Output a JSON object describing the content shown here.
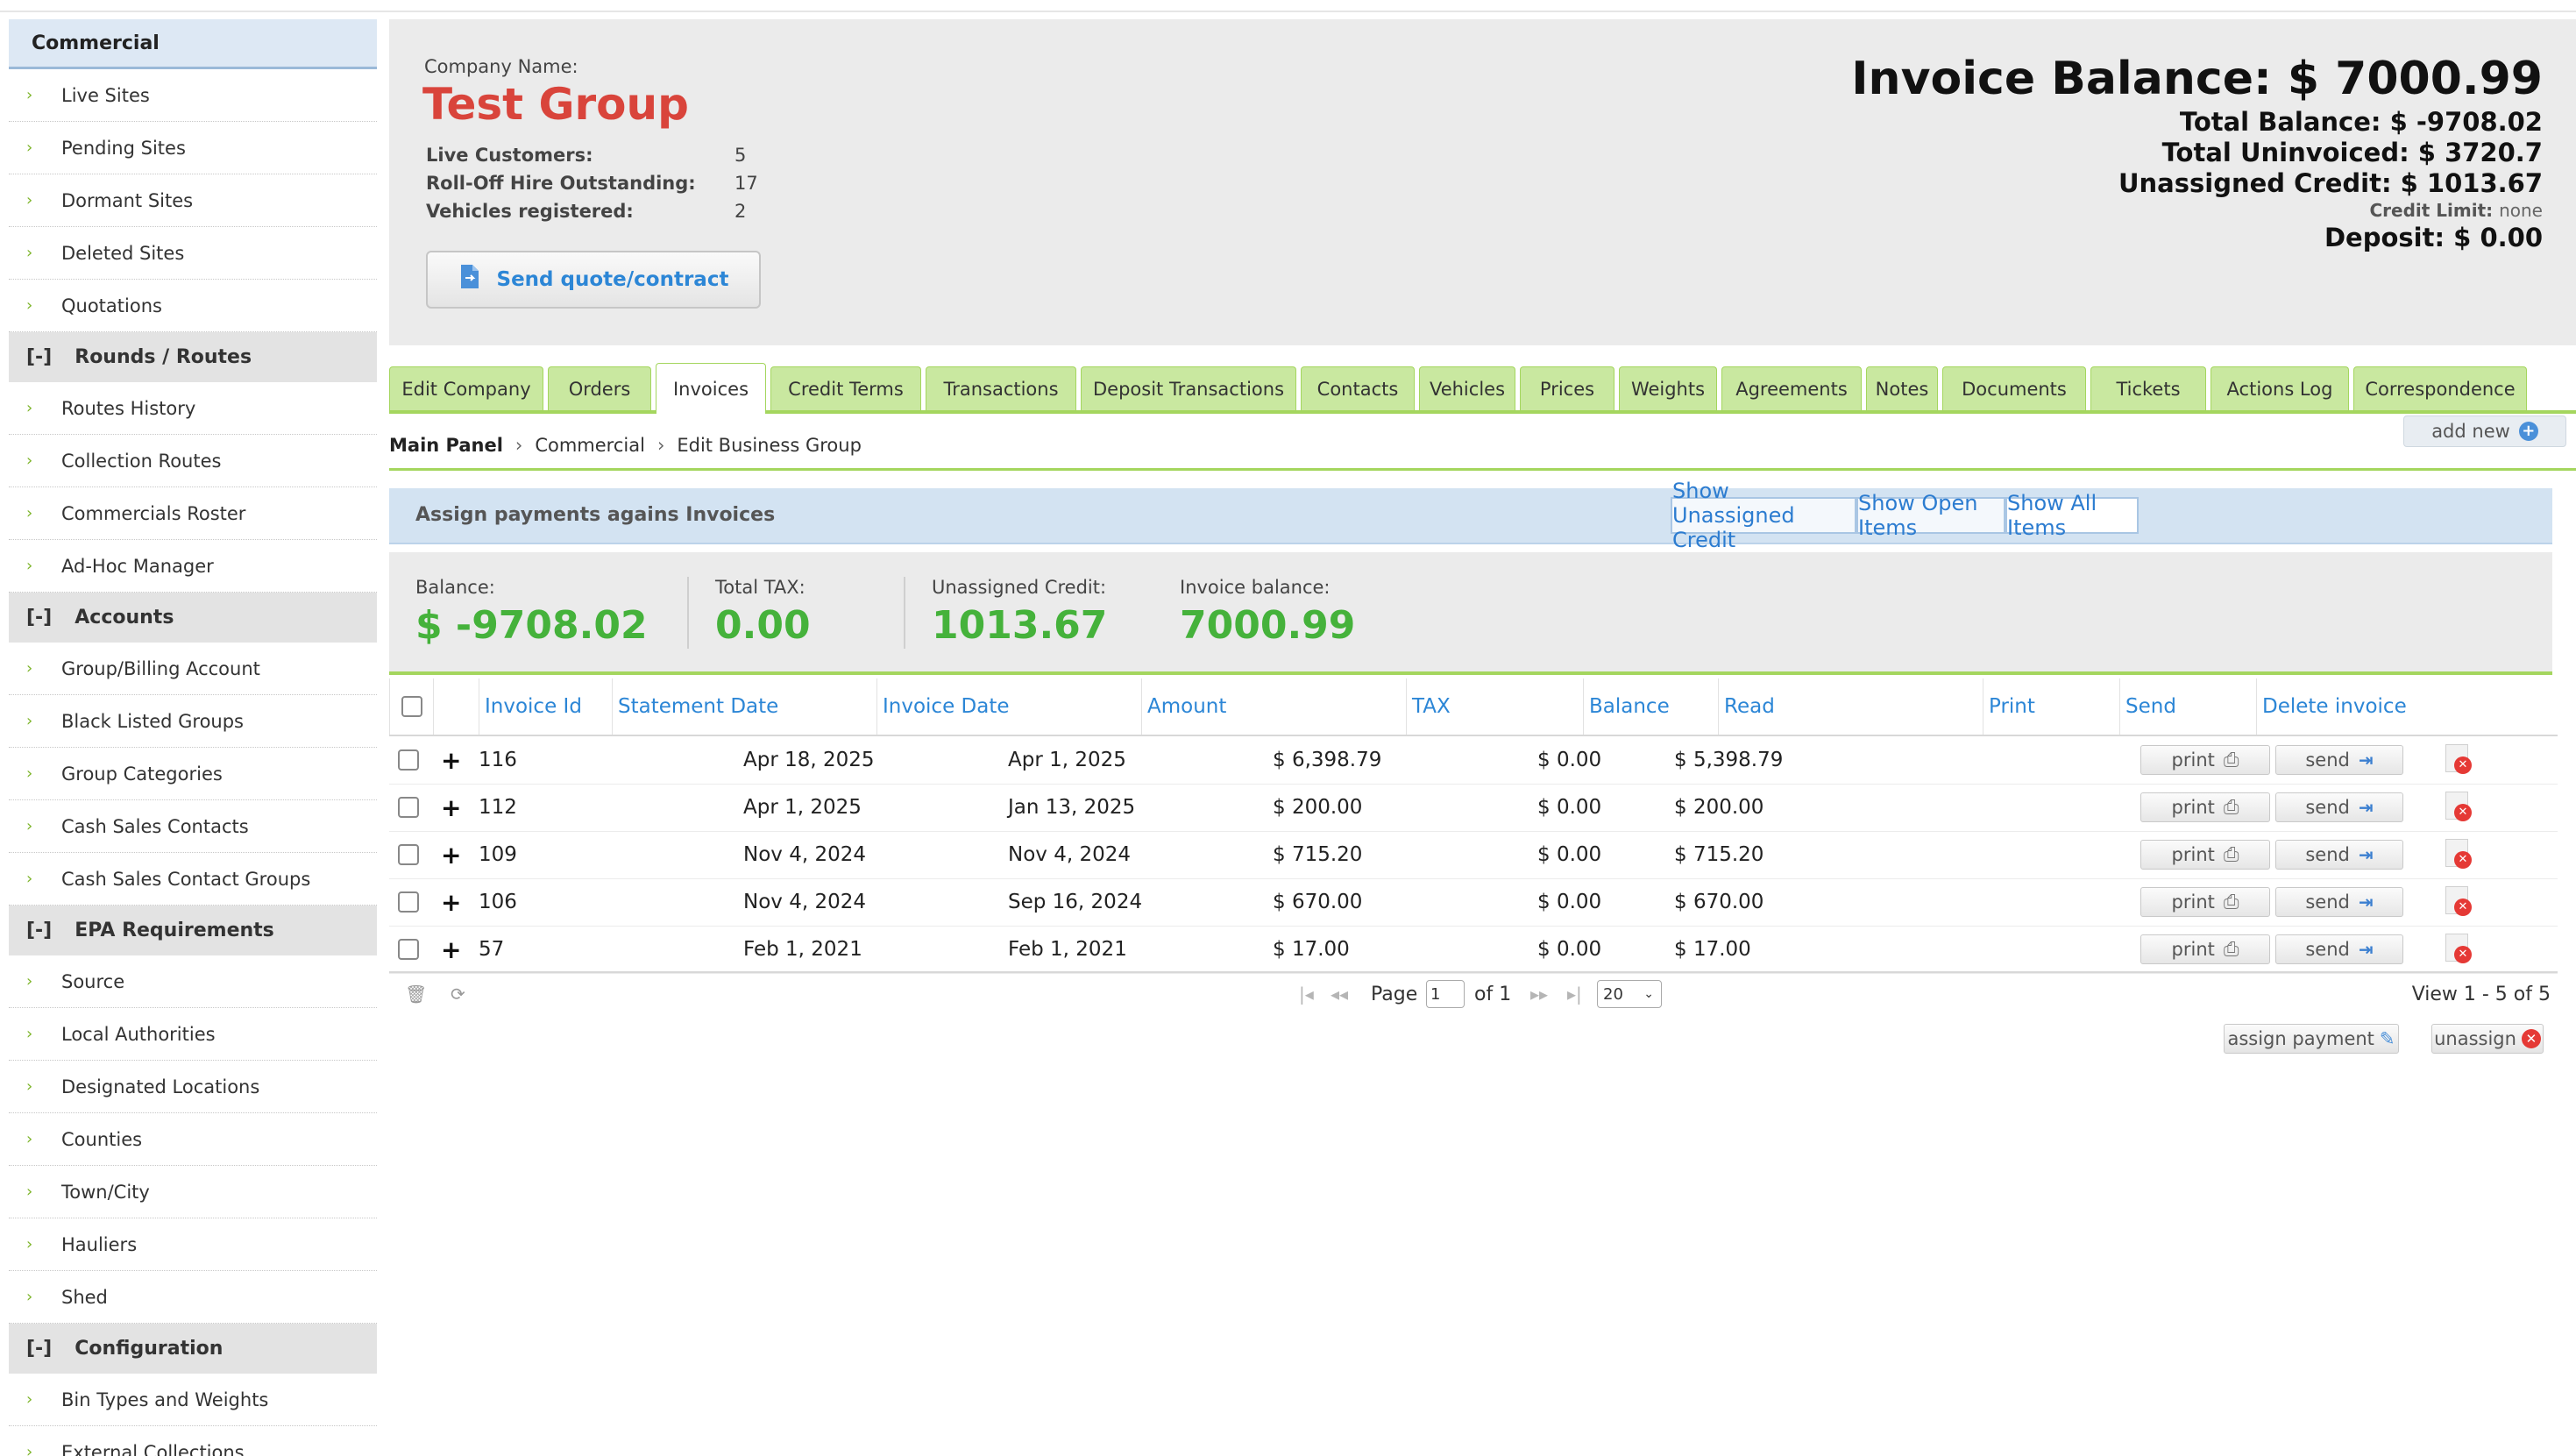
{
  "sidebar": {
    "header": "Commercial",
    "items_commercial": [
      "Live Sites",
      "Pending Sites",
      "Dormant Sites",
      "Deleted Sites",
      "Quotations"
    ],
    "sections": [
      {
        "toggle": "[-]",
        "title": "Rounds / Routes",
        "items": [
          "Routes History",
          "Collection Routes",
          "Commercials Roster",
          "Ad-Hoc Manager"
        ]
      },
      {
        "toggle": "[-]",
        "title": "Accounts",
        "items": [
          "Group/Billing Account",
          "Black Listed Groups",
          "Group Categories",
          "Cash Sales Contacts",
          "Cash Sales Contact Groups"
        ]
      },
      {
        "toggle": "[-]",
        "title": "EPA Requirements",
        "items": [
          "Source",
          "Local Authorities",
          "Designated Locations",
          "Counties",
          "Town/City",
          "Hauliers",
          "Shed"
        ]
      },
      {
        "toggle": "[-]",
        "title": "Configuration",
        "items": [
          "Bin Types and Weights",
          "External Collections"
        ]
      }
    ]
  },
  "company": {
    "label": "Company Name:",
    "name": "Test Group",
    "stats": [
      {
        "label": "Live Customers:",
        "value": "5"
      },
      {
        "label": "Roll-Off Hire Outstanding:",
        "value": "17"
      },
      {
        "label": "Vehicles registered:",
        "value": "2"
      }
    ],
    "send_button": "Send quote/contract"
  },
  "balances": {
    "invoice_balance": "Invoice Balance: $ 7000.99",
    "total_balance": "Total Balance: $ -9708.02",
    "total_uninvoiced": "Total Uninvoiced: $ 3720.7",
    "unassigned_credit": "Unassigned Credit: $ 1013.67",
    "credit_limit_label": "Credit Limit:",
    "credit_limit_value": "none",
    "deposit": "Deposit: $ 0.00"
  },
  "tabs": [
    "Edit Company",
    "Orders",
    "Invoices",
    "Credit Terms",
    "Transactions",
    "Deposit Transactions",
    "Contacts",
    "Vehicles",
    "Prices",
    "Weights",
    "Agreements",
    "Notes",
    "Documents",
    "Tickets",
    "Actions Log",
    "Correspondence"
  ],
  "active_tab": "Invoices",
  "breadcrumb": {
    "root": "Main Panel",
    "mid": "Commercial",
    "current": "Edit Business Group",
    "sep": "›"
  },
  "add_new": "add new",
  "assign": {
    "title": "Assign payments agains Invoices",
    "buttons": [
      "Show Unassigned Credit",
      "Show Open Items",
      "Show All Items"
    ]
  },
  "summary": [
    {
      "label": "Balance:",
      "value": "$ -9708.02"
    },
    {
      "label": "Total TAX:",
      "value": "0.00"
    },
    {
      "label": "Unassigned Credit:",
      "value": "1013.67"
    },
    {
      "label": "Invoice balance:",
      "value": "7000.99"
    }
  ],
  "table": {
    "columns": [
      "Invoice Id",
      "Statement Date",
      "Invoice Date",
      "Amount",
      "TAX",
      "Balance",
      "Read",
      "Print",
      "Send",
      "Delete invoice"
    ],
    "print_label": "print",
    "send_label": "send",
    "rows": [
      {
        "id": "116",
        "statement": "Apr 18, 2025",
        "invoice": "Apr 1, 2025",
        "amount": "$ 6,398.79",
        "tax": "$ 0.00",
        "balance": "$ 5,398.79"
      },
      {
        "id": "112",
        "statement": "Apr 1, 2025",
        "invoice": "Jan 13, 2025",
        "amount": "$ 200.00",
        "tax": "$ 0.00",
        "balance": "$ 200.00"
      },
      {
        "id": "109",
        "statement": "Nov 4, 2024",
        "invoice": "Nov 4, 2024",
        "amount": "$ 715.20",
        "tax": "$ 0.00",
        "balance": "$ 715.20"
      },
      {
        "id": "106",
        "statement": "Nov 4, 2024",
        "invoice": "Sep 16, 2024",
        "amount": "$ 670.00",
        "tax": "$ 0.00",
        "balance": "$ 670.00"
      },
      {
        "id": "57",
        "statement": "Feb 1, 2021",
        "invoice": "Feb 1, 2021",
        "amount": "$ 17.00",
        "tax": "$ 0.00",
        "balance": "$ 17.00"
      }
    ]
  },
  "pager": {
    "page_label": "Page",
    "page_value": "1",
    "of_label": "of 1",
    "rows_per_page": "20",
    "view_text": "View 1 - 5 of 5"
  },
  "actions": {
    "assign_payment": "assign payment",
    "unassign": "unassign"
  },
  "colors": {
    "accent_green": "#a4d65e",
    "value_green": "#45b23b",
    "company_red": "#d9443b",
    "link_blue": "#2c86d6"
  }
}
